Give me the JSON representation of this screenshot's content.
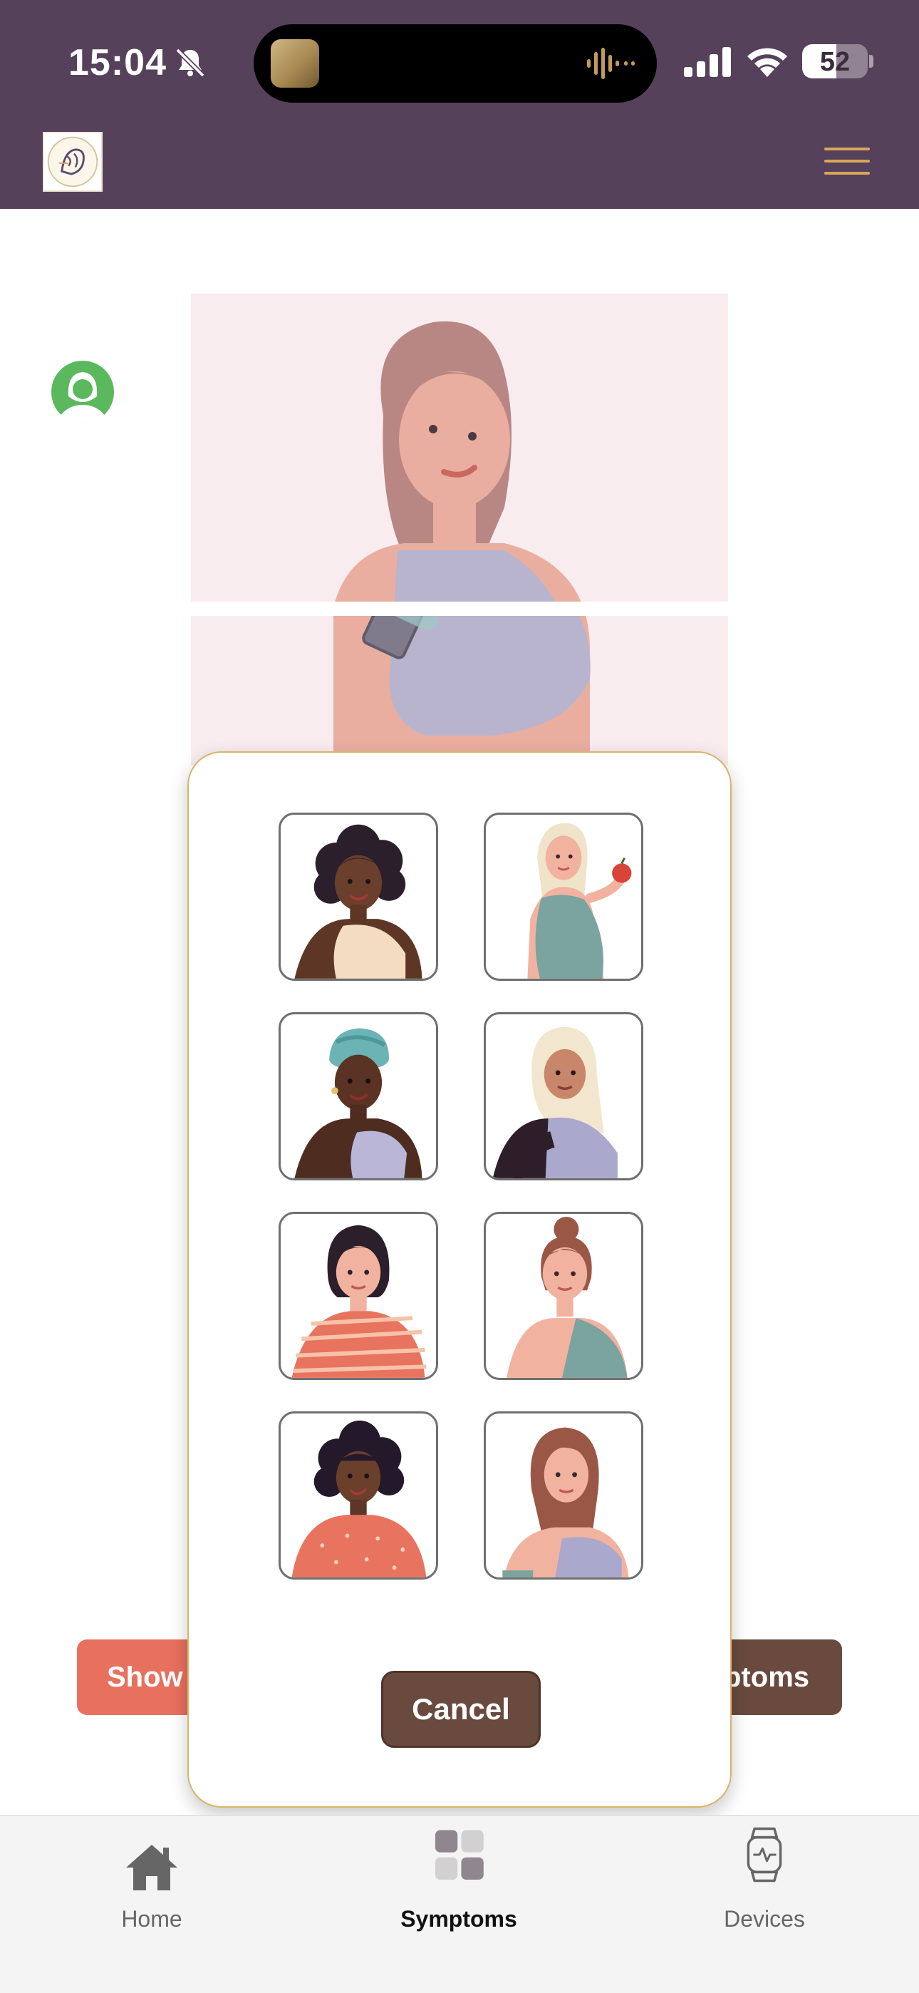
{
  "status_bar": {
    "time": "15:04",
    "battery_percent": "52",
    "battery_level": 0.52,
    "icons": [
      "bell-slash-icon",
      "signal-icon",
      "wifi-icon",
      "battery-icon"
    ]
  },
  "header": {
    "logo_icon": "app-logo-icon",
    "menu_icon": "hamburger-menu-icon",
    "colors": {
      "background": "#56415a",
      "menu_lines": "#d9a65a"
    }
  },
  "background_page": {
    "show_button_label": "Show",
    "symptoms_button_label": "ptoms",
    "colors": {
      "show_button": "#e8705f",
      "symptoms_button": "#6a4a3e",
      "hero_bg": "#f9ecef"
    }
  },
  "avatar_modal": {
    "avatars": [
      {
        "id": "avatar-1",
        "icon": "woman-curly-hair-avatar"
      },
      {
        "id": "avatar-2",
        "icon": "pregnant-woman-apple-avatar"
      },
      {
        "id": "avatar-3",
        "icon": "woman-turban-avatar"
      },
      {
        "id": "avatar-4",
        "icon": "woman-hijab-avatar"
      },
      {
        "id": "avatar-5",
        "icon": "woman-short-bob-avatar"
      },
      {
        "id": "avatar-6",
        "icon": "woman-hair-bun-avatar"
      },
      {
        "id": "avatar-7",
        "icon": "woman-curly-orange-top-avatar"
      },
      {
        "id": "avatar-8",
        "icon": "woman-long-hair-avatar"
      }
    ],
    "cancel_label": "Cancel",
    "colors": {
      "border": "#d9b46a",
      "cancel_button": "#6a4a3e"
    }
  },
  "tab_bar": {
    "tabs": [
      {
        "label": "Home",
        "icon": "home-icon"
      },
      {
        "label": "Symptoms",
        "icon": "grid-icon",
        "active": true
      },
      {
        "label": "Devices",
        "icon": "smartwatch-icon"
      }
    ]
  }
}
